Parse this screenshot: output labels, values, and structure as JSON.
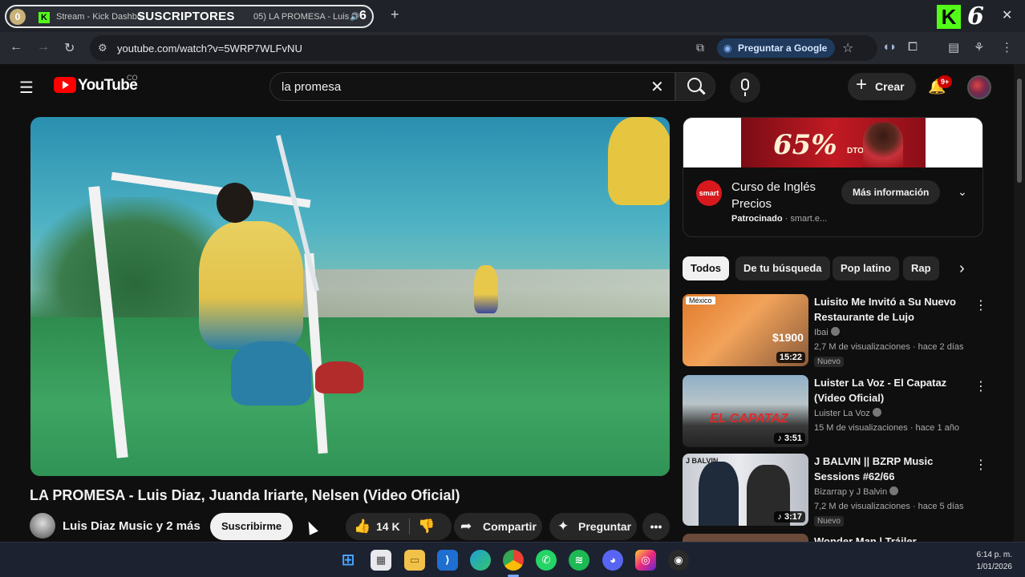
{
  "browser": {
    "tab1_text": "Stream - Kick Dashbo",
    "tab2_text": "05) LA PROMESA - Luis D",
    "overlay_badge": "0",
    "overlay_label": "SUSCRIPTORES",
    "overlay_count": "6",
    "kick_count": "6",
    "url": "youtube.com/watch?v=5WRP7WLFvNU",
    "ask_google_label": "Preguntar a Google"
  },
  "header": {
    "logo_text": "YouTube",
    "country_code": "CO",
    "search_value": "la promesa",
    "create_label": "Crear",
    "notification_badge": "9+"
  },
  "video": {
    "title": "LA PROMESA - Luis Diaz, Juanda Iriarte, Nelsen (Video Oficial)",
    "channel": "Luis Diaz Music y 2 más",
    "subscribe_label": "Suscribirme",
    "likes": "14 K",
    "share_label": "Compartir",
    "ask_label": "Preguntar"
  },
  "ad": {
    "banner_pct": "65%",
    "banner_dto": "DTO",
    "logo_text": "smart",
    "title": "Curso de Inglés Precios",
    "sponsored": "Patrocinado",
    "advertiser": "smart.e...",
    "more_info_label": "Más información"
  },
  "chips": [
    "Todos",
    "De tu búsqueda",
    "Pop latino",
    "Rap"
  ],
  "recommendations": [
    {
      "title": "Luisito Me Invitó a Su Nuevo Restaurante de Lujo",
      "channel": "Ibai",
      "meta": "2,7 M de visualizaciones · hace 2 días",
      "badge": "Nuevo",
      "duration": "15:22",
      "thumb_tag": "México",
      "thumb_price": "$1900"
    },
    {
      "title": "Luister La Voz - El Capataz (Video Oficial)",
      "channel": "Luister La Voz",
      "meta": "15 M de visualizaciones · hace 1 año",
      "badge": "",
      "duration": "3:51",
      "thumb_text": "EL CAPATAZ"
    },
    {
      "title": "J BALVIN || BZRP Music Sessions #62/66",
      "channel": "Bizarrap y J Balvin",
      "meta": "7,2 M de visualizaciones · hace 5 días",
      "badge": "Nuevo",
      "duration": "3:17",
      "thumb_tag": "J BALVIN"
    },
    {
      "title": "Wonder Man | Tráiler",
      "channel": "",
      "meta": "",
      "badge": "",
      "duration": ""
    }
  ],
  "taskbar": {
    "time": "6:14 p. m.",
    "date": "1/01/2026"
  }
}
